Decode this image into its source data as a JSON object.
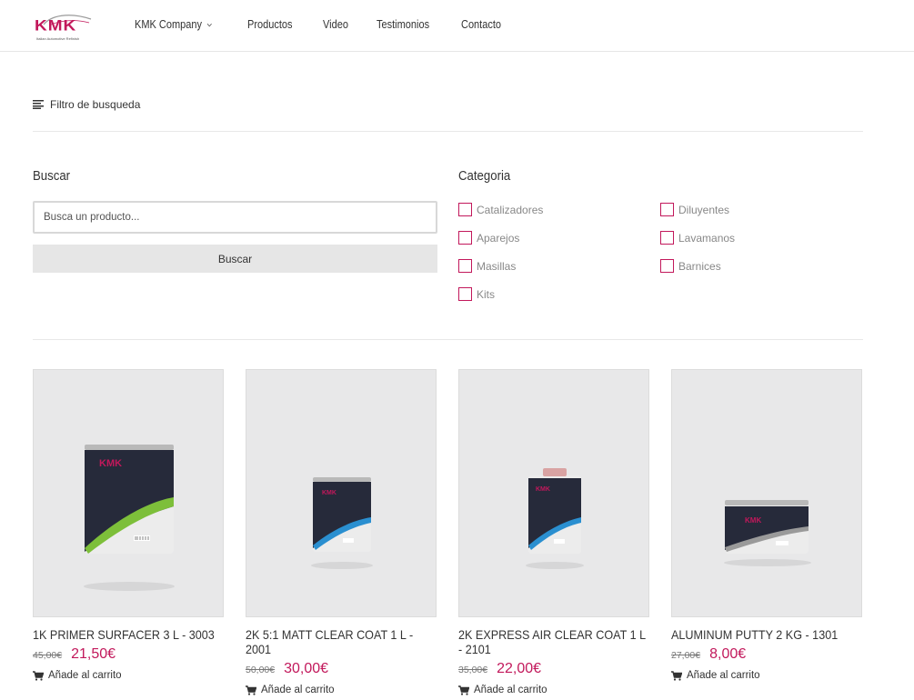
{
  "header": {
    "logo_text": "KMK",
    "logo_subtitle": "Italian Automotive Refinish",
    "nav": [
      "KMK Company",
      "Productos",
      "Video",
      "Testimonios",
      "Contacto"
    ]
  },
  "filter": {
    "toggle_label": "Filtro de busqueda",
    "search_title": "Buscar",
    "search_placeholder": "Busca un producto...",
    "search_button": "Buscar",
    "category_title": "Categoria",
    "categories": [
      "Catalizadores",
      "Diluyentes",
      "Aparejos",
      "Lavamanos",
      "Masillas",
      "Barnices",
      "Kits"
    ]
  },
  "products": [
    {
      "name": "1K PRIMER SURFACER 3 L - 3003",
      "old_price": "45,00€",
      "price": "21,50€",
      "cart": "Añade al carrito",
      "accent": "#7dbf3a"
    },
    {
      "name": "2K 5:1 MATT CLEAR COAT 1 L - 2001",
      "old_price": "50,00€",
      "price": "30,00€",
      "cart": "Añade al carrito",
      "accent": "#2a8fd0"
    },
    {
      "name": "2K EXPRESS AIR CLEAR COAT 1 L - 2101",
      "old_price": "35,00€",
      "price": "22,00€",
      "cart": "Añade al carrito",
      "accent": "#2a8fd0"
    },
    {
      "name": "ALUMINUM PUTTY 2 KG - 1301",
      "old_price": "27,00€",
      "price": "8,00€",
      "cart": "Añade al carrito",
      "accent": "#9a9a9a"
    }
  ],
  "colors": {
    "brand": "#c2185b",
    "text": "#333333",
    "muted": "#888888"
  }
}
